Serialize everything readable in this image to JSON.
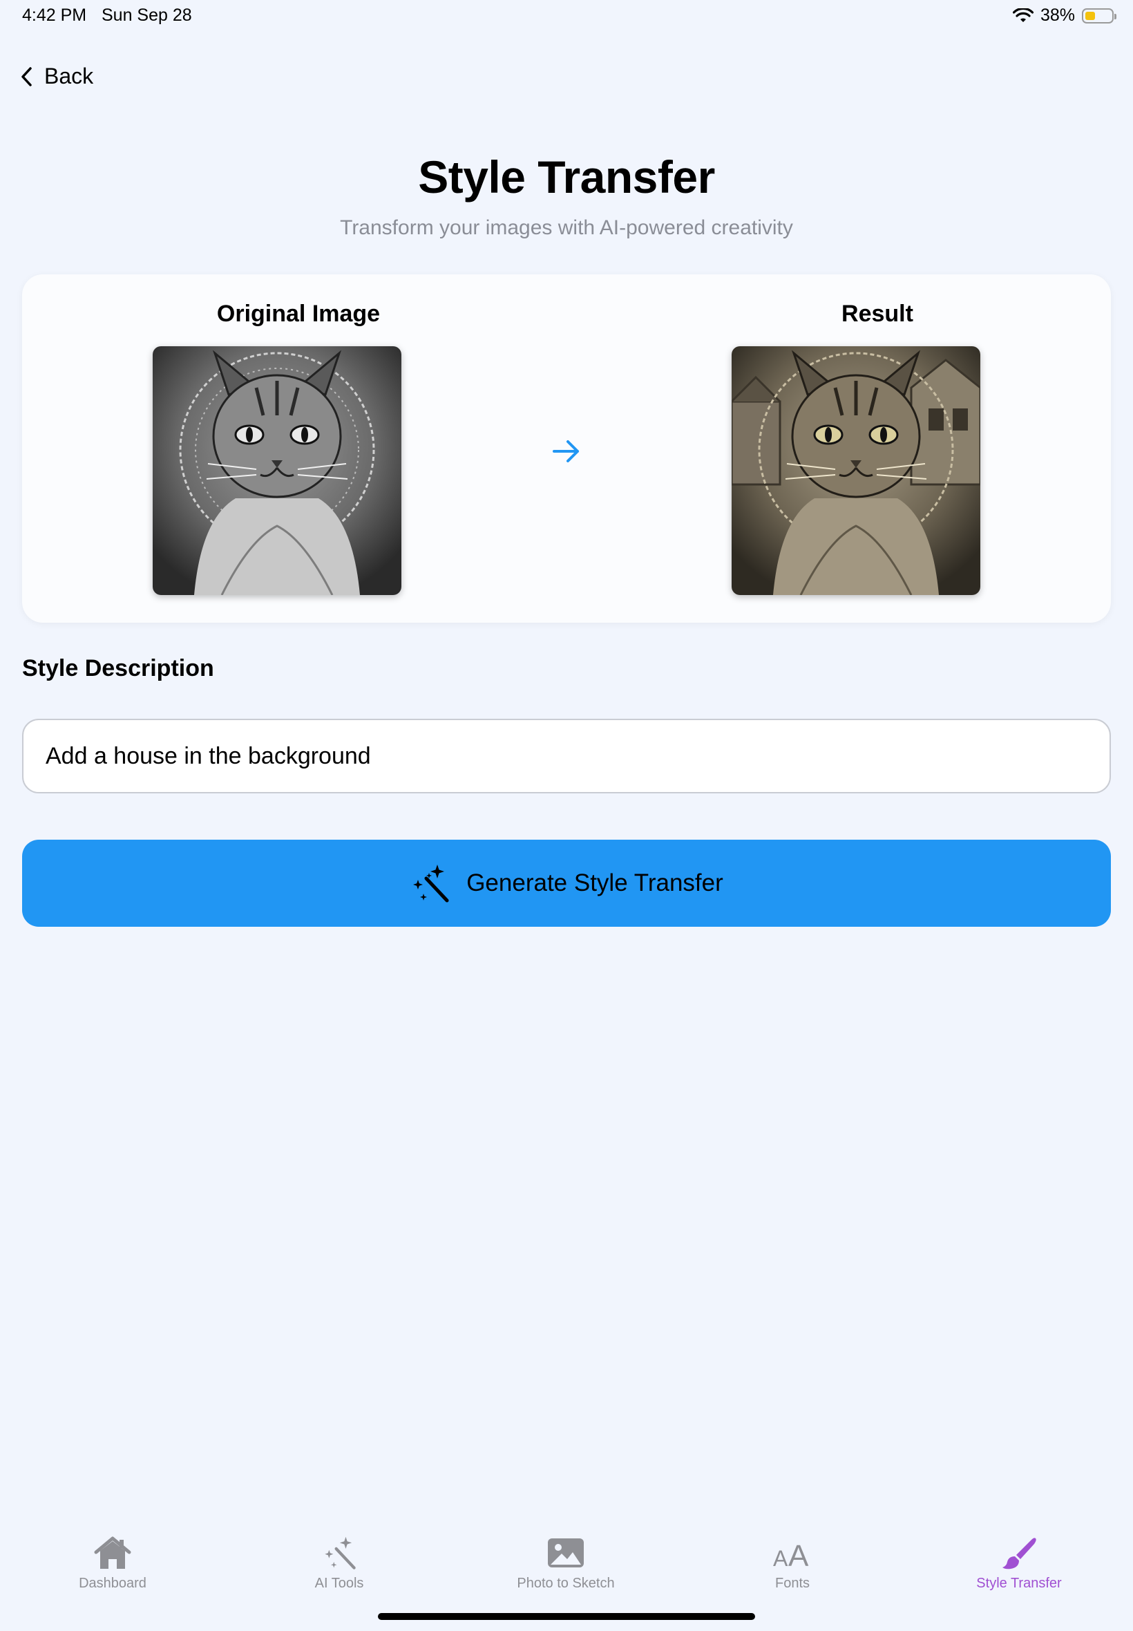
{
  "status": {
    "time": "4:42 PM",
    "date": "Sun Sep 28",
    "battery": "38%",
    "battery_level": 0.38
  },
  "nav": {
    "back_label": "Back"
  },
  "header": {
    "title": "Style Transfer",
    "subtitle": "Transform your images with AI-powered creativity"
  },
  "comparison": {
    "original_label": "Original Image",
    "result_label": "Result"
  },
  "style": {
    "label": "Style Description",
    "value": "Add a house in the background"
  },
  "generate_button": {
    "label": "Generate Style Transfer"
  },
  "tabs": [
    {
      "label": "Dashboard",
      "icon": "house-icon"
    },
    {
      "label": "AI Tools",
      "icon": "magic-wand-icon"
    },
    {
      "label": "Photo to Sketch",
      "icon": "photo-icon"
    },
    {
      "label": "Fonts",
      "icon": "text-size-icon"
    },
    {
      "label": "Style Transfer",
      "icon": "paintbrush-icon",
      "active": true
    }
  ],
  "colors": {
    "accent": "#2196f3",
    "active_tab": "#a050d2",
    "inactive_tab": "#8e8f94",
    "background": "#f1f5fd"
  }
}
